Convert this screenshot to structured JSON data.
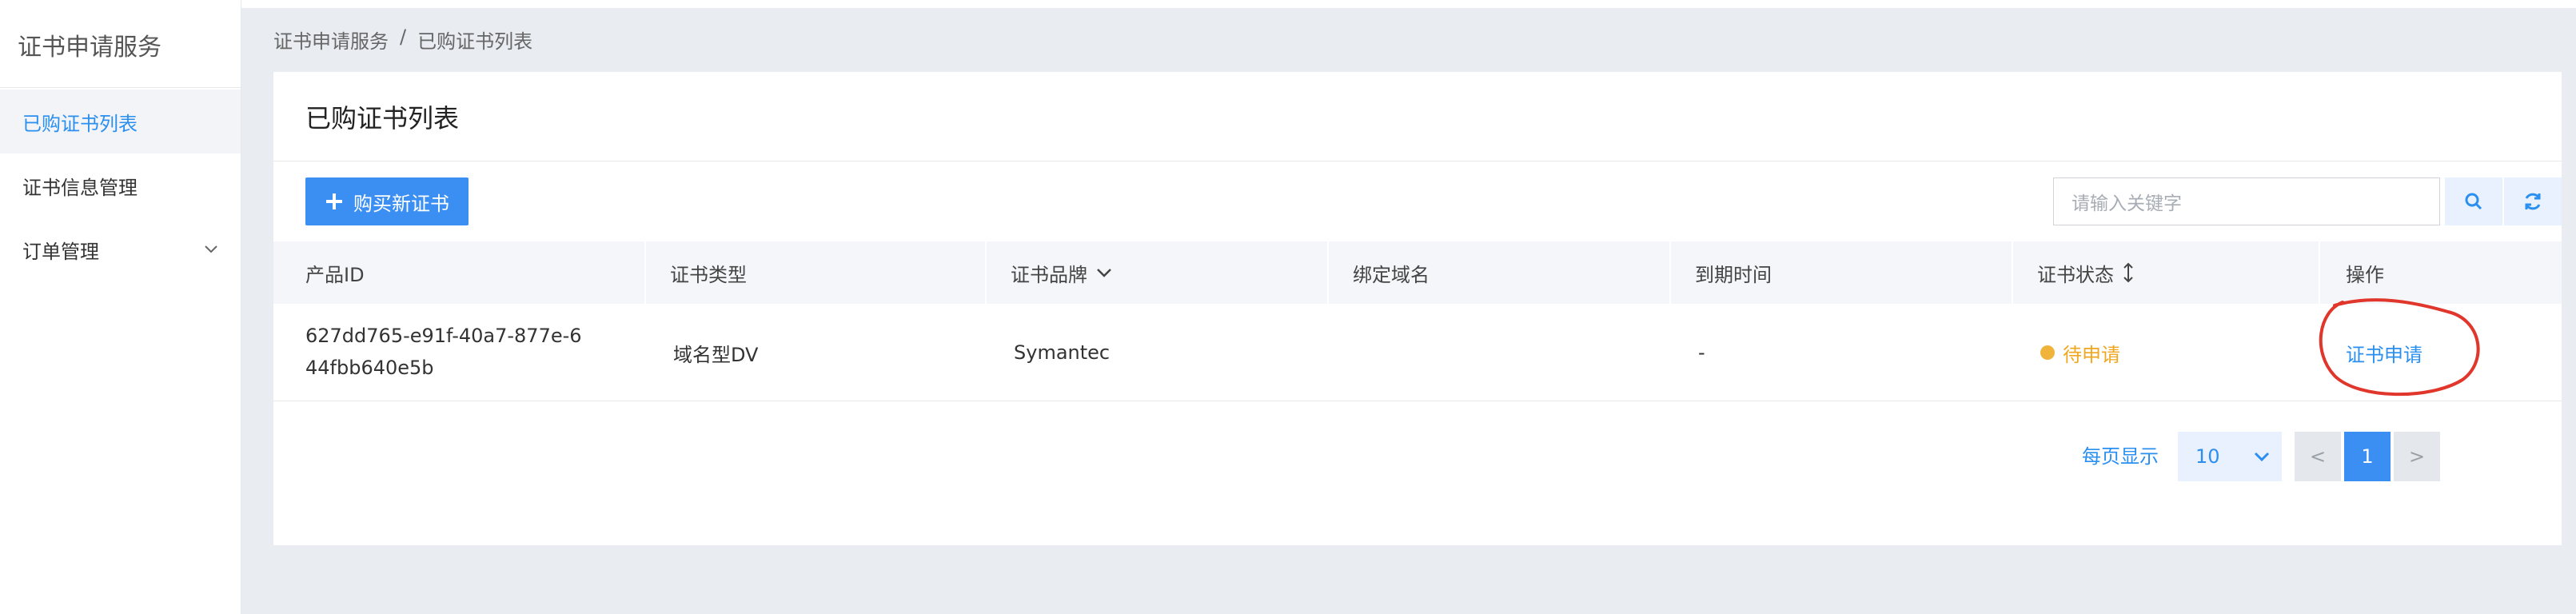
{
  "sidebar": {
    "title": "证书申请服务",
    "items": [
      {
        "label": "已购证书列表",
        "active": true
      },
      {
        "label": "证书信息管理",
        "active": false
      },
      {
        "label": "订单管理",
        "active": false,
        "icon": "chevron-down-icon"
      }
    ]
  },
  "breadcrumb": {
    "root": "证书申请服务",
    "separator": "/",
    "current": "已购证书列表"
  },
  "panel": {
    "title": "已购证书列表"
  },
  "toolbar": {
    "buy_label": "购买新证书",
    "buy_icon": "plus-icon",
    "search_placeholder": "请输入关键字",
    "search_icon": "search-icon",
    "refresh_icon": "refresh-icon"
  },
  "table": {
    "headers": [
      "产品ID",
      "证书类型",
      "证书品牌",
      "绑定域名",
      "到期时间",
      "证书状态",
      "操作"
    ],
    "rows": [
      {
        "product_id": "627dd765-e91f-40a7-877e-644fbb640e5b",
        "type": "域名型DV",
        "brand": "Symantec",
        "domain": "",
        "expiry": "-",
        "status": "待申请",
        "action": "证书申请"
      }
    ]
  },
  "pagination": {
    "per_page_label": "每页显示",
    "page_size": "10",
    "prev": "<",
    "current": "1",
    "next": ">"
  },
  "colors": {
    "accent": "#3b8ff2",
    "status_pending": "#f0a71f",
    "annotation": "#e0362b"
  }
}
